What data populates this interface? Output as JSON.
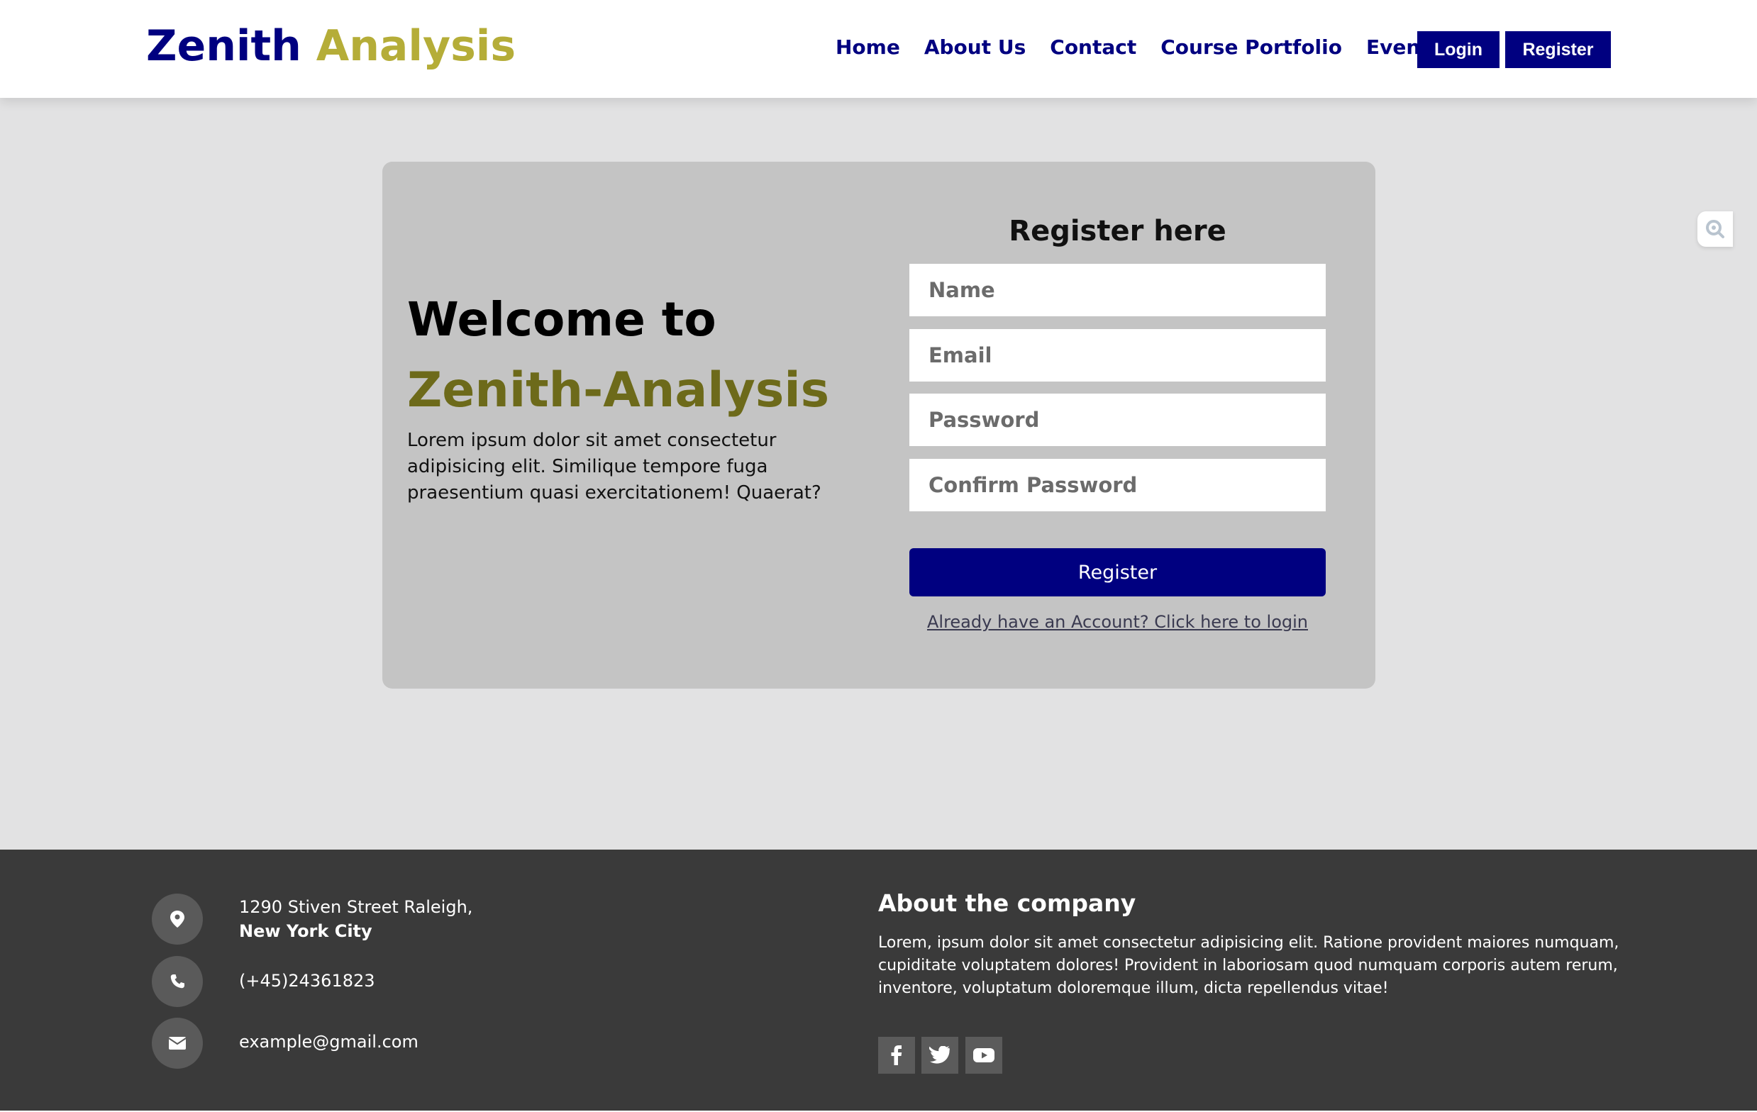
{
  "header": {
    "logo_part1": "Zenith",
    "logo_part2": "Analysis",
    "nav": [
      "Home",
      "About Us",
      "Contact",
      "Course Portfolio",
      "Event"
    ],
    "login_label": "Login",
    "register_label": "Register"
  },
  "card": {
    "welcome": "Welcome to",
    "brand": "Zenith-Analysis",
    "intro": "Lorem ipsum dolor sit amet consectetur adipisicing elit. Similique tempore fuga praesentium quasi exercitationem! Quaerat?",
    "form_title": "Register here",
    "fields": {
      "name_placeholder": "Name",
      "email_placeholder": "Email",
      "password_placeholder": "Password",
      "confirm_placeholder": "Confirm Password"
    },
    "submit_label": "Register",
    "login_link": "Already have an Account? Click here to login"
  },
  "footer": {
    "address_line1": "1290 Stiven Street Raleigh,",
    "address_line2": "New York City",
    "phone": "(+45)24361823",
    "email": "example@gmail.com",
    "about_title": "About the company",
    "about_text": "Lorem, ipsum dolor sit amet consectetur adipisicing elit. Ratione provident maiores numquam, cupiditate voluptatem dolores! Provident in laboriosam quod numquam corporis autem rerum, inventore, voluptatum doloremque illum, dicta repellendus vitae!",
    "social_icons": [
      "facebook-icon",
      "twitter-icon",
      "youtube-icon"
    ]
  },
  "colors": {
    "brand_navy": "#000080",
    "brand_gold": "#b5ad38",
    "brand_olive": "#6d6a1a",
    "card_bg": "#c4c4c4",
    "footer_bg": "#3a3a3a"
  }
}
